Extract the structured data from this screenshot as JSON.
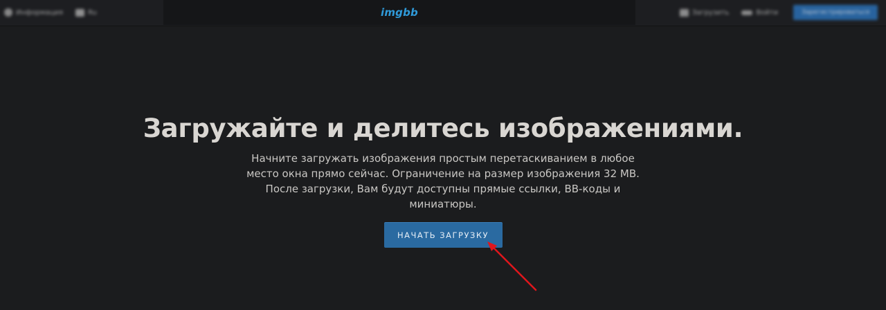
{
  "header": {
    "logo": "imgbb",
    "left_items": [
      {
        "label": "Информация",
        "icon": "info-circle-icon"
      },
      {
        "label": "Ru",
        "icon": "language-icon"
      }
    ],
    "right_items": [
      {
        "label": "Загрузить",
        "icon": "upload-bag-icon"
      },
      {
        "label": "Войти",
        "icon": "login-key-icon"
      }
    ],
    "signup_label": "Зарегистрироваться"
  },
  "hero": {
    "title": "Загружайте и делитесь изображениями.",
    "description": "Начните загружать изображения простым перетаскиванием в любое место окна прямо сейчас. Ограничение на размер изображения 32 MB. После загрузки, Вам будут доступны прямые ссылки, BB-коды и миниатюры.",
    "button_label": "НАЧАТЬ ЗАГРУЗКУ"
  },
  "annotation": {
    "arrow_color": "#e0161c",
    "icon": "red-arrow-annotation"
  },
  "colors": {
    "background": "#1b1c1e",
    "brand": "#2f9ad9",
    "button": "#2a6aa1"
  }
}
